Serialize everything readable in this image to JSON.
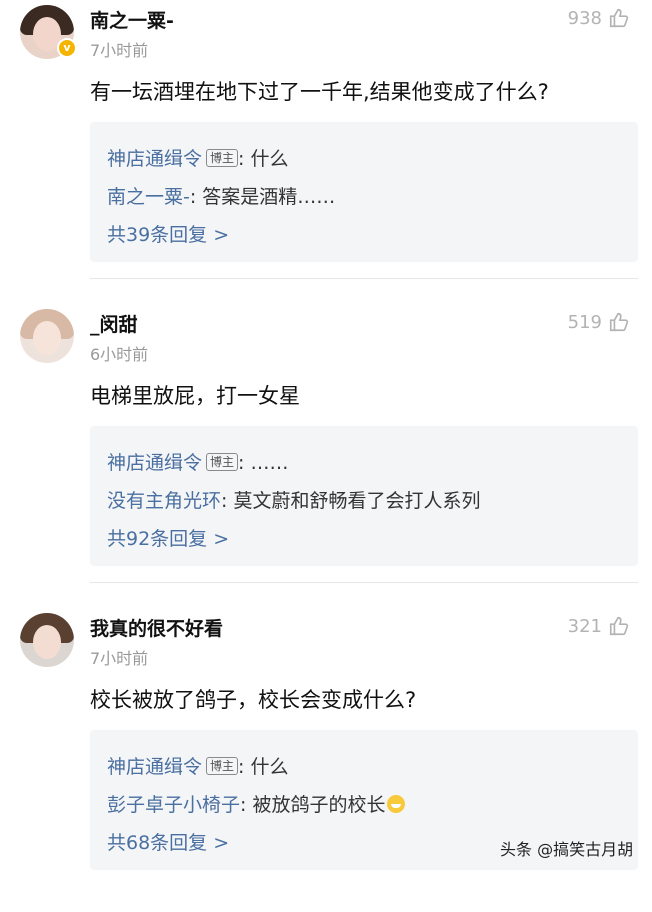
{
  "comments": [
    {
      "username": "南之一粟-",
      "time": "7小时前",
      "likes": "938",
      "text": "有一坛酒埋在地下过了一千年,结果他变成了什么?",
      "verified_badge": "v",
      "replies": [
        {
          "author": "神店通缉令",
          "tag": "博主",
          "content": ": 什么"
        },
        {
          "author": "南之一粟-",
          "tag": "",
          "content": ": 答案是酒精……"
        }
      ],
      "more": "共39条回复 >"
    },
    {
      "username": "_闵甜",
      "time": "6小时前",
      "likes": "519",
      "text": "电梯里放屁，打一女星",
      "replies": [
        {
          "author": "神店通缉令",
          "tag": "博主",
          "content": ": ……"
        },
        {
          "author": "没有主角光环",
          "tag": "",
          "content": ": 莫文蔚和舒畅看了会打人系列"
        }
      ],
      "more": "共92条回复 >"
    },
    {
      "username": "我真的很不好看",
      "time": "7小时前",
      "likes": "321",
      "text": "校长被放了鸽子，校长会变成什么?",
      "replies": [
        {
          "author": "神店通缉令",
          "tag": "博主",
          "content": ": 什么"
        },
        {
          "author": "彭子卓子小椅子",
          "tag": "",
          "content": ": 被放鸽子的校长"
        }
      ],
      "more": "共68条回复 >"
    }
  ],
  "watermark": "头条 @搞笑古月胡",
  "icons": {
    "like": "thumbs-up-icon",
    "emoji": "grinning-face-icon"
  },
  "colors": {
    "link": "#4a6fa1",
    "muted": "#9a9a9a",
    "reply_bg": "#f4f5f7",
    "badge": "#f5b400"
  }
}
